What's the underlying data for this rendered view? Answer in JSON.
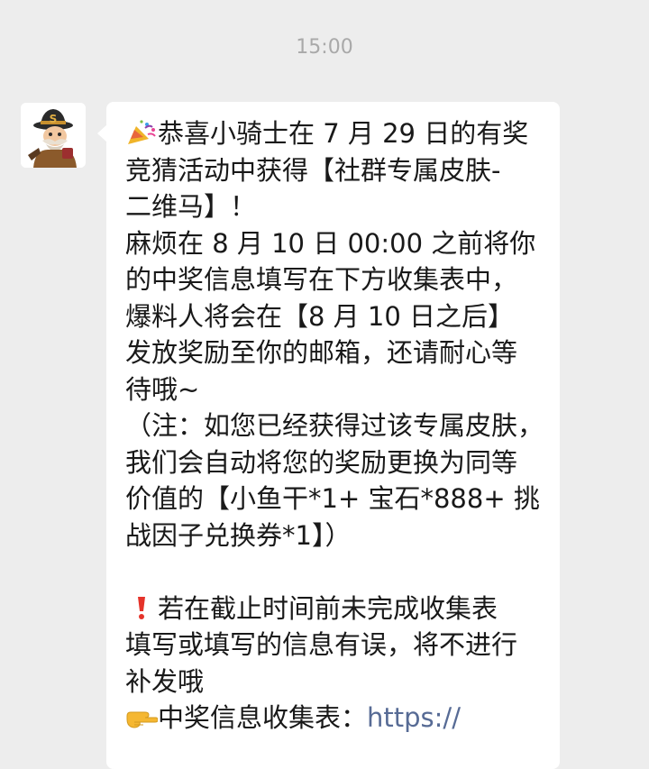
{
  "chat": {
    "timestamp": "15:00"
  },
  "sender": {
    "avatar_icon": "knight-character-avatar-icon"
  },
  "message": {
    "lines": [
      "恭喜小骑士在 7 月 29 日的有奖",
      "竞猜活动中获得【社群专属皮肤-",
      "二维马】！",
      "麻烦在 8 月 10 日 00:00 之前将你",
      "的中奖信息填写在下方收集表中，",
      "爆料人将会在【8 月 10 日之后】",
      "发放奖励至你的邮箱，还请耐心等",
      "待哦~",
      "（注：如您已经获得过该专属皮肤，",
      "我们会自动将您的奖励更换为同等",
      "价值的【小鱼干*1+ 宝石*888+ 挑",
      "战因子兑换券*1】）",
      "若在截止时间前未完成收集表",
      "填写或填写的信息有误，将不进行",
      "补发哦",
      "中奖信息收集表："
    ],
    "link_text": "https://",
    "icons": {
      "party": "party-popper-icon",
      "warning": "red-exclamation-icon",
      "pointing": "pointing-hand-icon"
    },
    "colors": {
      "bubble": "#ffffff",
      "background": "#ededed",
      "link": "#576b95",
      "text": "#191919"
    }
  }
}
